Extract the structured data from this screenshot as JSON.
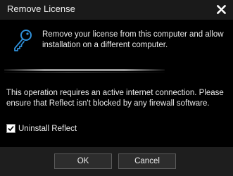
{
  "window": {
    "title": "Remove License"
  },
  "icons": {
    "close": "close-icon",
    "key": "key-icon",
    "check": "checkmark-icon"
  },
  "content": {
    "description": "Remove your license from this computer and allow installation on a different computer.",
    "notice": "This operation requires an active internet connection. Please ensure that Reflect isn't blocked by any firewall software."
  },
  "options": {
    "uninstall_label": "Uninstall Reflect",
    "uninstall_checked": true
  },
  "buttons": {
    "ok": "OK",
    "cancel": "Cancel"
  },
  "colors": {
    "background": "#000000",
    "accent": "#2f8fd8"
  }
}
